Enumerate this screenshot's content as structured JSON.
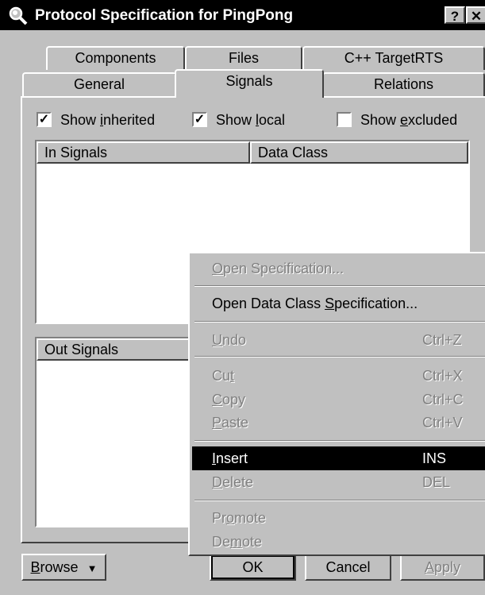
{
  "window": {
    "title": "Protocol Specification for PingPong",
    "help_label": "?",
    "close_label": "✕"
  },
  "tabs_row1": [
    "Components",
    "Files",
    "C++ TargetRTS"
  ],
  "tabs_row2": [
    "General",
    "Signals",
    "Relations"
  ],
  "active_tab": "Signals",
  "checkboxes": {
    "show_inherited": {
      "pre": "Show ",
      "key": "i",
      "post": "nherited",
      "checked": true
    },
    "show_local": {
      "pre": "Show ",
      "key": "l",
      "post": "ocal",
      "checked": true
    },
    "show_excluded": {
      "pre": "Show ",
      "key": "e",
      "post": "xcluded",
      "checked": false
    }
  },
  "in_signals": {
    "col1": "In Signals",
    "col2": "Data Class"
  },
  "out_signals": {
    "col1": "Out Signals"
  },
  "buttons": {
    "browse": {
      "key": "B",
      "rest": "rowse",
      "arrow": "▼"
    },
    "ok": "OK",
    "cancel": "Cancel",
    "apply": {
      "key": "A",
      "rest": "pply"
    }
  },
  "context_menu": {
    "open_spec": {
      "key": "O",
      "rest": "pen Specification..."
    },
    "open_dc_spec": {
      "pre": "Open Data Class ",
      "key": "S",
      "rest": "pecification..."
    },
    "undo": {
      "key": "U",
      "rest": "ndo",
      "shortcut": "Ctrl+Z"
    },
    "cut": {
      "pre": "Cu",
      "key": "t",
      "rest": "",
      "shortcut": "Ctrl+X"
    },
    "copy": {
      "key": "C",
      "rest": "opy",
      "shortcut": "Ctrl+C"
    },
    "paste": {
      "key": "P",
      "rest": "aste",
      "shortcut": "Ctrl+V"
    },
    "insert": {
      "key": "I",
      "rest": "nsert",
      "shortcut": "INS"
    },
    "delete": {
      "key": "D",
      "rest": "elete",
      "shortcut": "DEL"
    },
    "promote": {
      "pre": "Pr",
      "key": "o",
      "rest": "mote"
    },
    "demote": {
      "pre": "De",
      "key": "m",
      "rest": "ote"
    }
  }
}
